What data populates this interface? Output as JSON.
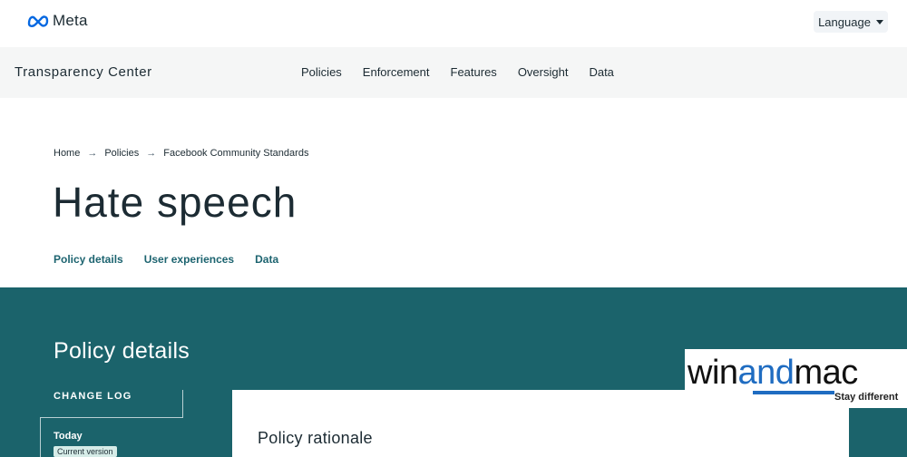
{
  "header": {
    "brand": "Meta",
    "language_label": "Language"
  },
  "nav": {
    "site_title": "Transparency Center",
    "links": [
      "Policies",
      "Enforcement",
      "Features",
      "Oversight",
      "Data"
    ]
  },
  "breadcrumb": [
    "Home",
    "Policies",
    "Facebook Community Standards"
  ],
  "page": {
    "title": "Hate speech",
    "tabs": [
      "Policy details",
      "User experiences",
      "Data"
    ]
  },
  "policy": {
    "section_title": "Policy details",
    "change_log_label": "CHANGE LOG",
    "log_entry_label": "Today",
    "log_entry_badge": "Current version",
    "card_title": "Policy rationale"
  },
  "watermark": {
    "brand_prefix": "win",
    "brand_highlight": "and",
    "brand_suffix": "mac",
    "tagline": "Stay different"
  },
  "colors": {
    "teal": "#1b636b",
    "link_teal": "#1d6470",
    "meta_blue": "#0668e1",
    "watermark_blue": "#1f6cc1"
  }
}
